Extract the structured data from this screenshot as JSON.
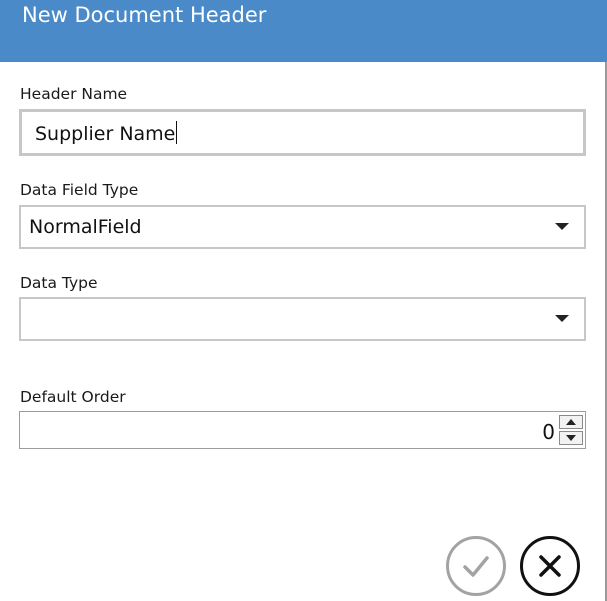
{
  "dialog": {
    "title": "New Document Header"
  },
  "form": {
    "header_name": {
      "label": "Header Name",
      "value": "Supplier Name"
    },
    "data_field_type": {
      "label": "Data Field Type",
      "selected": "NormalField"
    },
    "data_type": {
      "label": "Data Type",
      "selected": ""
    },
    "default_order": {
      "label": "Default Order",
      "value": "0"
    }
  },
  "actions": {
    "ok_icon": "checkmark-icon",
    "cancel_icon": "close-icon"
  },
  "colors": {
    "titlebar": "#4a8ac8",
    "ok_disabled": "#a3a3a3",
    "cancel": "#111111"
  }
}
